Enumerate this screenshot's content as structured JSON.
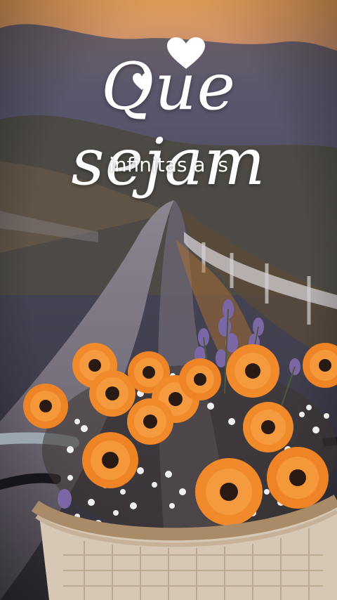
{
  "overlay": {
    "title": "Que sejam",
    "subtitle": "infinitas a  s"
  },
  "palette": {
    "sky_top": "#e9a25c",
    "sky_bottom": "#6d6a80",
    "road": "#6e6776",
    "grass": "#4a4a3c",
    "petal": "#f08a2b",
    "flower_center": "#2a1a14",
    "small_flower": "#ffffff",
    "lavender": "#7b67a6",
    "basket": "#d9cbb8"
  },
  "icons": [
    "heart-icon",
    "heart-small-icon"
  ]
}
